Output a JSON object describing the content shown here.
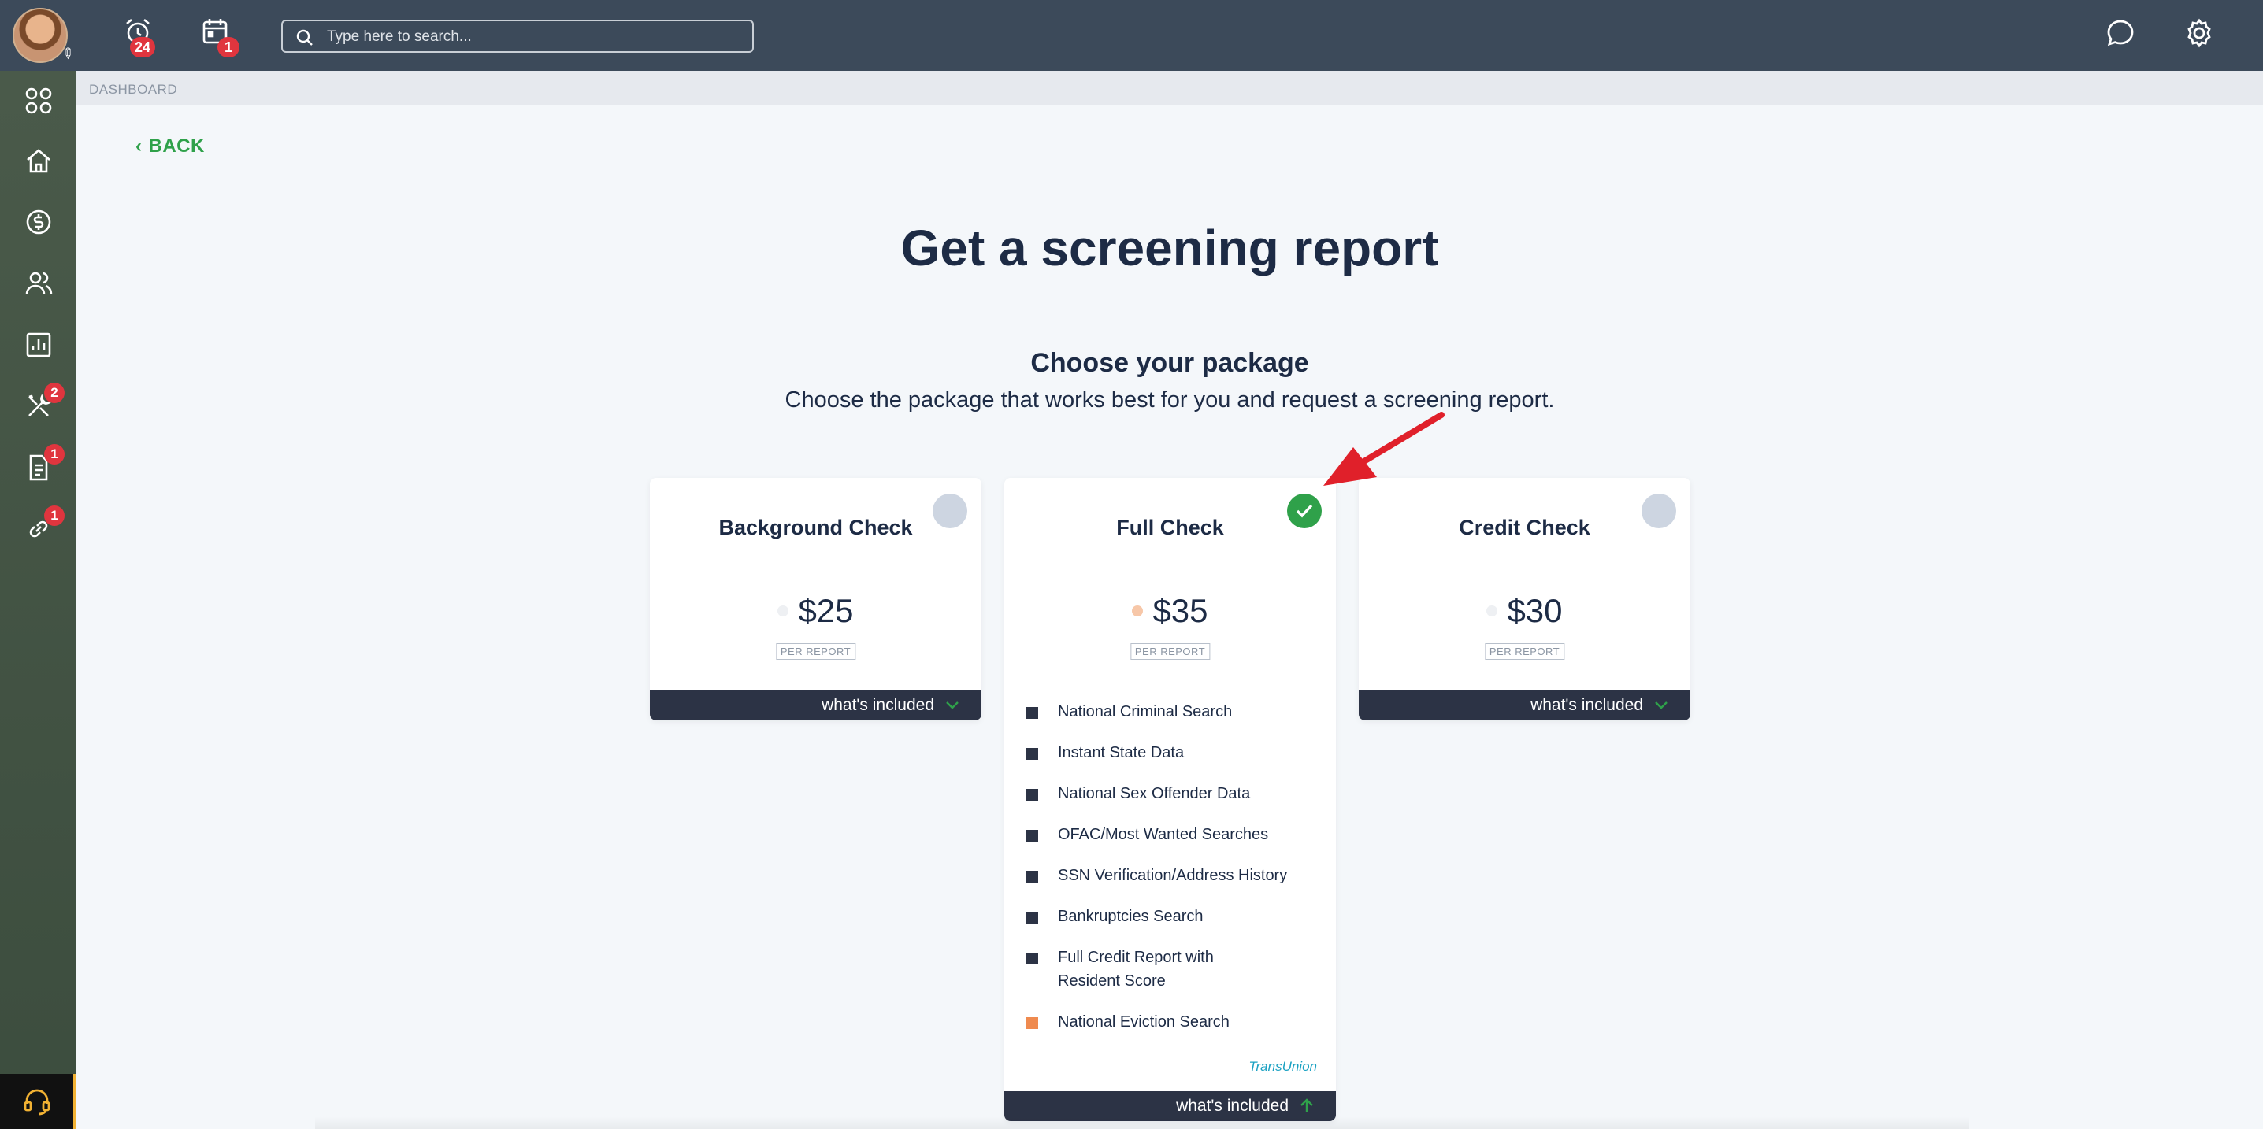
{
  "topbar": {
    "alarm_badge": "24",
    "calendar_badge": "1",
    "search_placeholder": "Type here to search..."
  },
  "sidebar": {
    "items": [
      {
        "icon": "apps-icon"
      },
      {
        "icon": "home-icon"
      },
      {
        "icon": "dollar-icon"
      },
      {
        "icon": "people-icon"
      },
      {
        "icon": "chart-icon"
      },
      {
        "icon": "tools-icon",
        "badge": "2"
      },
      {
        "icon": "document-icon",
        "badge": "1"
      },
      {
        "icon": "link-icon",
        "badge": "1"
      }
    ],
    "support_icon": "headset-icon"
  },
  "breadcrumb": "DASHBOARD",
  "back_label": "BACK",
  "title": "Get a screening report",
  "subtitle": "Choose your package",
  "description": "Choose the package that works best for you and request a screening report.",
  "cards": [
    {
      "name": "Background Check",
      "price": "$25",
      "per": "PER REPORT",
      "included": "what's included",
      "selected": false
    },
    {
      "name": "Full Check",
      "price": "$35",
      "per": "PER REPORT",
      "included": "what's included",
      "selected": true,
      "features": [
        "National Criminal Search",
        "Instant State Data",
        "National Sex Offender Data",
        "OFAC/Most Wanted Searches",
        "SSN Verification/Address History",
        "Bankruptcies Search",
        "Full Credit Report with Resident Score",
        "National Eviction Search"
      ],
      "provider": "TransUnion"
    },
    {
      "name": "Credit Check",
      "price": "$30",
      "per": "PER REPORT",
      "included": "what's included",
      "selected": false
    }
  ],
  "colors": {
    "accent_green": "#2fa14a",
    "navy": "#1d2b45",
    "badge_red": "#e0353e",
    "eviction_bullet": "#ef8a4f",
    "annotation_arrow": "#e0202a"
  }
}
